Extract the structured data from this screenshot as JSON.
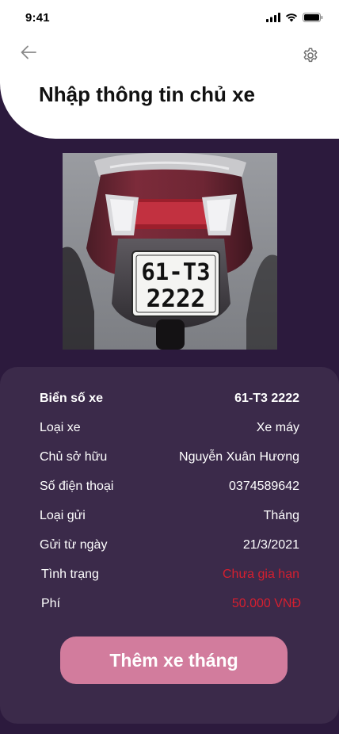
{
  "status_bar": {
    "time": "9:41"
  },
  "header": {
    "title": "Nhập thông tin chủ xe",
    "back_icon": "arrow-left-icon",
    "settings_icon": "gear-icon"
  },
  "photo": {
    "plate_line1": "61-T3",
    "plate_line2": "2222"
  },
  "info": {
    "rows": [
      {
        "label": "Biển số xe",
        "value": "61-T3 2222"
      },
      {
        "label": "Loại xe",
        "value": "Xe máy"
      },
      {
        "label": "Chủ sở hữu",
        "value": "Nguyễn Xuân Hương"
      },
      {
        "label": "Số điện thoại",
        "value": "0374589642"
      },
      {
        "label": "Loại gửi",
        "value": "Tháng"
      },
      {
        "label": "Gửi từ ngày",
        "value": "21/3/2021"
      },
      {
        "label": "Tình trạng",
        "value": "Chưa gia hạn"
      },
      {
        "label": "Phí",
        "value": "50.000 VNĐ"
      }
    ]
  },
  "actions": {
    "add_monthly_label": "Thêm xe tháng"
  },
  "colors": {
    "background": "#2c1a3d",
    "card": "#3b2a4a",
    "button": "#d27c9d",
    "alert_red": "#d61f2f"
  }
}
